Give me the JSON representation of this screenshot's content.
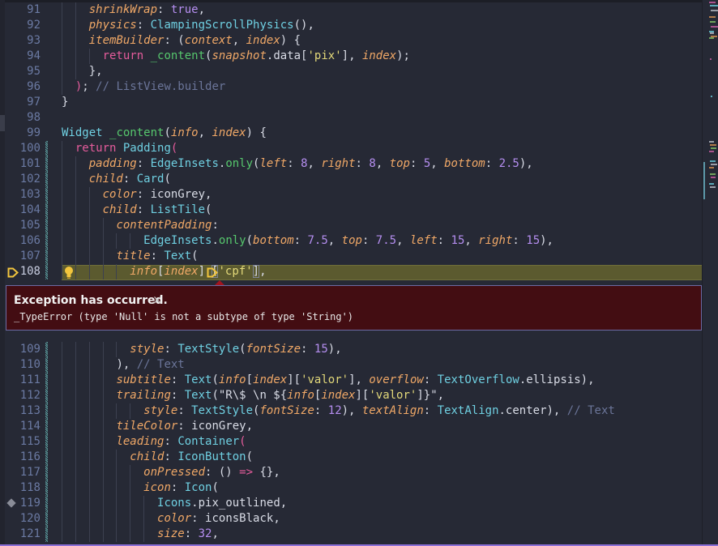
{
  "editor": {
    "active_line": 108,
    "lines_before": [
      {
        "n": 91,
        "indent": 4,
        "t": [
          [
            "p",
            "shrinkWrap"
          ],
          [
            "d",
            ": "
          ],
          [
            "n",
            "true"
          ],
          [
            "d",
            ","
          ]
        ]
      },
      {
        "n": 92,
        "indent": 4,
        "t": [
          [
            "p",
            "physics"
          ],
          [
            "d",
            ": "
          ],
          [
            "c",
            "ClampingScrollPhysics"
          ],
          [
            "d",
            "(),"
          ]
        ]
      },
      {
        "n": 93,
        "indent": 4,
        "t": [
          [
            "p",
            "itemBuilder"
          ],
          [
            "d",
            ": ("
          ],
          [
            "i",
            "context"
          ],
          [
            "d",
            ", "
          ],
          [
            "i",
            "index"
          ],
          [
            "d",
            ") {"
          ]
        ]
      },
      {
        "n": 94,
        "indent": 6,
        "t": [
          [
            "k",
            "return"
          ],
          [
            "d",
            " "
          ],
          [
            "f",
            "_content"
          ],
          [
            "d",
            "("
          ],
          [
            "i",
            "snapshot"
          ],
          [
            "d",
            ".data["
          ],
          [
            "s",
            "'pix'"
          ],
          [
            "d",
            "], "
          ],
          [
            "i",
            "index"
          ],
          [
            "d",
            ");"
          ]
        ]
      },
      {
        "n": 95,
        "indent": 4,
        "t": [
          [
            "d",
            "},"
          ]
        ]
      },
      {
        "n": 96,
        "indent": 2,
        "t": [
          [
            "k",
            ")"
          ],
          [
            "d",
            "; "
          ],
          [
            "cm",
            "// ListView.builder"
          ]
        ]
      },
      {
        "n": 97,
        "indent": 0,
        "t": [
          [
            "d",
            "}"
          ]
        ]
      },
      {
        "n": 98,
        "indent": 0,
        "t": []
      },
      {
        "n": 99,
        "indent": 0,
        "t": [
          [
            "c",
            "Widget"
          ],
          [
            "d",
            " "
          ],
          [
            "f",
            "_content"
          ],
          [
            "d",
            "("
          ],
          [
            "i",
            "info"
          ],
          [
            "d",
            ", "
          ],
          [
            "i",
            "index"
          ],
          [
            "d",
            ") {"
          ]
        ]
      },
      {
        "n": 100,
        "indent": 2,
        "chg": true,
        "t": [
          [
            "k",
            "return"
          ],
          [
            "d",
            " "
          ],
          [
            "c",
            "Padding"
          ],
          [
            "k",
            "("
          ]
        ]
      },
      {
        "n": 101,
        "indent": 4,
        "chg": true,
        "t": [
          [
            "p",
            "padding"
          ],
          [
            "d",
            ": "
          ],
          [
            "c",
            "EdgeInsets"
          ],
          [
            "d",
            "."
          ],
          [
            "f",
            "only"
          ],
          [
            "d",
            "("
          ],
          [
            "p",
            "left"
          ],
          [
            "d",
            ": "
          ],
          [
            "n",
            "8"
          ],
          [
            "d",
            ", "
          ],
          [
            "p",
            "right"
          ],
          [
            "d",
            ": "
          ],
          [
            "n",
            "8"
          ],
          [
            "d",
            ", "
          ],
          [
            "p",
            "top"
          ],
          [
            "d",
            ": "
          ],
          [
            "n",
            "5"
          ],
          [
            "d",
            ", "
          ],
          [
            "p",
            "bottom"
          ],
          [
            "d",
            ": "
          ],
          [
            "n",
            "2.5"
          ],
          [
            "d",
            "),"
          ]
        ]
      },
      {
        "n": 102,
        "indent": 4,
        "chg": true,
        "t": [
          [
            "p",
            "child"
          ],
          [
            "d",
            ": "
          ],
          [
            "c",
            "Card"
          ],
          [
            "d",
            "("
          ]
        ]
      },
      {
        "n": 103,
        "indent": 6,
        "chg": true,
        "t": [
          [
            "p",
            "color"
          ],
          [
            "d",
            ": iconGrey,"
          ]
        ]
      },
      {
        "n": 104,
        "indent": 6,
        "chg": true,
        "t": [
          [
            "p",
            "child"
          ],
          [
            "d",
            ": "
          ],
          [
            "c",
            "ListTile"
          ],
          [
            "d",
            "("
          ]
        ]
      },
      {
        "n": 105,
        "indent": 8,
        "chg": true,
        "t": [
          [
            "p",
            "contentPadding"
          ],
          [
            "d",
            ":"
          ]
        ]
      },
      {
        "n": 106,
        "indent": 12,
        "chg": true,
        "t": [
          [
            "c",
            "EdgeInsets"
          ],
          [
            "d",
            "."
          ],
          [
            "f",
            "only"
          ],
          [
            "d",
            "("
          ],
          [
            "p",
            "bottom"
          ],
          [
            "d",
            ": "
          ],
          [
            "n",
            "7.5"
          ],
          [
            "d",
            ", "
          ],
          [
            "p",
            "top"
          ],
          [
            "d",
            ": "
          ],
          [
            "n",
            "7.5"
          ],
          [
            "d",
            ", "
          ],
          [
            "p",
            "left"
          ],
          [
            "d",
            ": "
          ],
          [
            "n",
            "15"
          ],
          [
            "d",
            ", "
          ],
          [
            "p",
            "right"
          ],
          [
            "d",
            ": "
          ],
          [
            "n",
            "15"
          ],
          [
            "d",
            "),"
          ]
        ]
      },
      {
        "n": 107,
        "indent": 8,
        "chg": true,
        "t": [
          [
            "p",
            "title"
          ],
          [
            "d",
            ": "
          ],
          [
            "c",
            "Text"
          ],
          [
            "d",
            "("
          ]
        ]
      },
      {
        "n": 108,
        "indent": 10,
        "chg": true,
        "t": [
          [
            "i",
            "info"
          ],
          [
            "d",
            "["
          ],
          [
            "i",
            "index"
          ],
          [
            "d",
            "]"
          ],
          [
            "mark",
            "  "
          ],
          [
            "box",
            "["
          ],
          [
            "s",
            "'cpf'"
          ],
          [
            "box",
            "]"
          ],
          [
            "d",
            ","
          ]
        ]
      }
    ],
    "lines_after": [
      {
        "n": 109,
        "indent": 10,
        "chg": true,
        "t": [
          [
            "p",
            "style"
          ],
          [
            "d",
            ": "
          ],
          [
            "c",
            "TextStyle"
          ],
          [
            "d",
            "("
          ],
          [
            "p",
            "fontSize"
          ],
          [
            "d",
            ": "
          ],
          [
            "n",
            "15"
          ],
          [
            "d",
            "),"
          ]
        ]
      },
      {
        "n": 110,
        "indent": 8,
        "chg": true,
        "t": [
          [
            "d",
            "), "
          ],
          [
            "cm",
            "// Text"
          ]
        ]
      },
      {
        "n": 111,
        "indent": 8,
        "chg": true,
        "t": [
          [
            "p",
            "subtitle"
          ],
          [
            "d",
            ": "
          ],
          [
            "c",
            "Text"
          ],
          [
            "d",
            "("
          ],
          [
            "i",
            "info"
          ],
          [
            "d",
            "["
          ],
          [
            "i",
            "index"
          ],
          [
            "d",
            "]["
          ],
          [
            "s",
            "'valor'"
          ],
          [
            "d",
            "], "
          ],
          [
            "p",
            "overflow"
          ],
          [
            "d",
            ": "
          ],
          [
            "c",
            "TextOverflow"
          ],
          [
            "d",
            ".ellipsis),"
          ]
        ]
      },
      {
        "n": 112,
        "indent": 8,
        "chg": true,
        "t": [
          [
            "p",
            "trailing"
          ],
          [
            "d",
            ": "
          ],
          [
            "c",
            "Text"
          ],
          [
            "d",
            "(\"R\\$ \\n ${"
          ],
          [
            "i",
            "info"
          ],
          [
            "d",
            "["
          ],
          [
            "i",
            "index"
          ],
          [
            "d",
            "]["
          ],
          [
            "s",
            "'valor'"
          ],
          [
            "d",
            "]}\","
          ]
        ]
      },
      {
        "n": 113,
        "indent": 12,
        "chg": true,
        "t": [
          [
            "p",
            "style"
          ],
          [
            "d",
            ": "
          ],
          [
            "c",
            "TextStyle"
          ],
          [
            "d",
            "("
          ],
          [
            "p",
            "fontSize"
          ],
          [
            "d",
            ": "
          ],
          [
            "n",
            "12"
          ],
          [
            "d",
            "), "
          ],
          [
            "p",
            "textAlign"
          ],
          [
            "d",
            ": "
          ],
          [
            "c",
            "TextAlign"
          ],
          [
            "d",
            ".center), "
          ],
          [
            "cm",
            "// Text"
          ]
        ]
      },
      {
        "n": 114,
        "indent": 8,
        "chg": true,
        "t": [
          [
            "p",
            "tileColor"
          ],
          [
            "d",
            ": iconGrey,"
          ]
        ]
      },
      {
        "n": 115,
        "indent": 8,
        "chg": true,
        "t": [
          [
            "p",
            "leading"
          ],
          [
            "d",
            ": "
          ],
          [
            "c",
            "Container"
          ],
          [
            "k",
            "("
          ]
        ]
      },
      {
        "n": 116,
        "indent": 10,
        "chg": true,
        "t": [
          [
            "p",
            "child"
          ],
          [
            "d",
            ": "
          ],
          [
            "c",
            "IconButton"
          ],
          [
            "d",
            "("
          ]
        ]
      },
      {
        "n": 117,
        "indent": 12,
        "chg": true,
        "t": [
          [
            "p",
            "onPressed"
          ],
          [
            "d",
            ": () "
          ],
          [
            "k",
            "=>"
          ],
          [
            "d",
            " {},"
          ]
        ]
      },
      {
        "n": 118,
        "indent": 12,
        "chg": true,
        "t": [
          [
            "p",
            "icon"
          ],
          [
            "d",
            ": "
          ],
          [
            "c",
            "Icon"
          ],
          [
            "d",
            "("
          ]
        ]
      },
      {
        "n": 119,
        "indent": 14,
        "chg": true,
        "t": [
          [
            "c",
            "Icons"
          ],
          [
            "d",
            ".pix_outlined,"
          ]
        ]
      },
      {
        "n": 120,
        "indent": 14,
        "chg": true,
        "t": [
          [
            "p",
            "color"
          ],
          [
            "d",
            ": iconsBlack,"
          ]
        ]
      },
      {
        "n": 121,
        "indent": 14,
        "chg": true,
        "t": [
          [
            "p",
            "size"
          ],
          [
            "d",
            ": "
          ],
          [
            "n",
            "32"
          ],
          [
            "d",
            ","
          ]
        ]
      }
    ]
  },
  "exception": {
    "title": "Exception has occurred.",
    "close_icon": "×",
    "message": "_TypeError (type 'Null' is not a subtype of type 'String')"
  },
  "colors": {
    "background": "#262935",
    "exception_bg": "#430d12",
    "highlight_line": "#5b5a2f",
    "keyword": "#e55c9c",
    "parameter": "#f0a867",
    "class": "#6fd0e2",
    "string": "#e3d97a",
    "number": "#b58ef0",
    "comment": "#6b7599"
  }
}
